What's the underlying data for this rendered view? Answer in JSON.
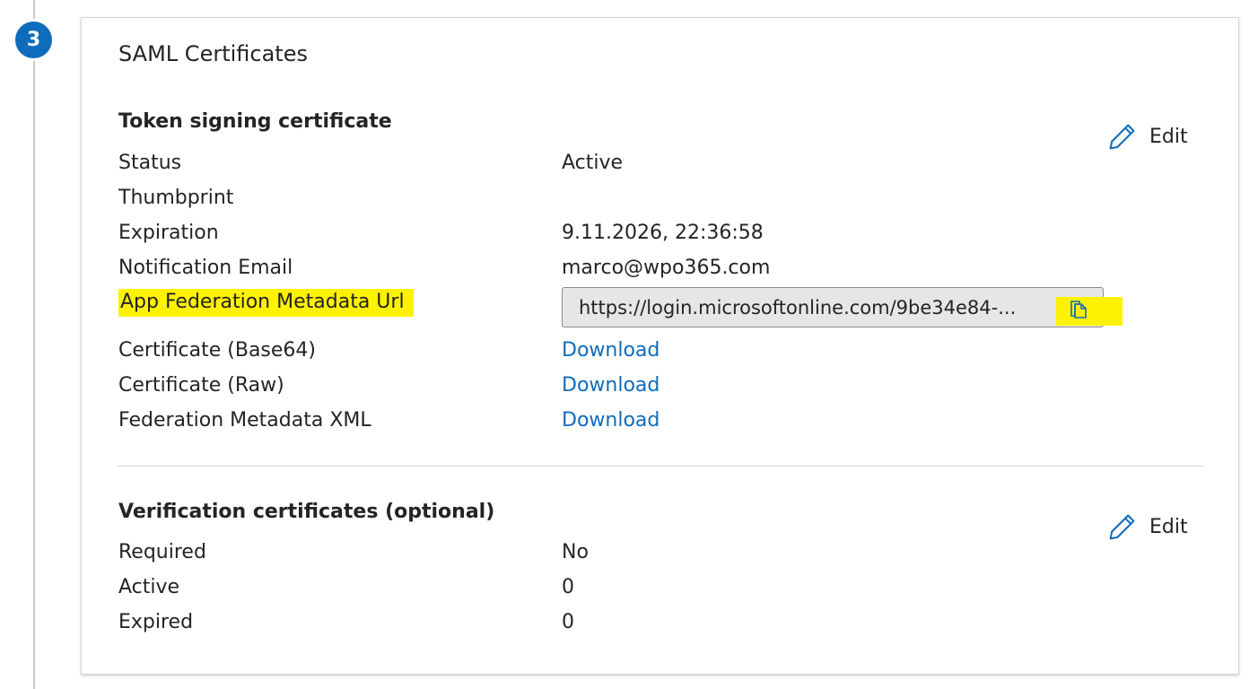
{
  "step": {
    "number": "3"
  },
  "card": {
    "title": "SAML Certificates"
  },
  "token_signing": {
    "title": "Token signing certificate",
    "edit_label": "Edit",
    "rows": {
      "status": {
        "label": "Status",
        "value": "Active"
      },
      "thumbprint": {
        "label": "Thumbprint",
        "value": ""
      },
      "expiration": {
        "label": "Expiration",
        "value": "9.11.2026, 22:36:58"
      },
      "notification_email": {
        "label": "Notification Email",
        "value": "marco@wpo365.com"
      },
      "metadata_url": {
        "label": "App Federation Metadata Url",
        "value": "https://login.microsoftonline.com/9be34e84-..."
      },
      "cert_base64": {
        "label": "Certificate (Base64)",
        "value": "Download"
      },
      "cert_raw": {
        "label": "Certificate (Raw)",
        "value": "Download"
      },
      "federation_xml": {
        "label": "Federation Metadata XML",
        "value": "Download"
      }
    }
  },
  "verification": {
    "title": "Verification certificates (optional)",
    "edit_label": "Edit",
    "rows": {
      "required": {
        "label": "Required",
        "value": "No"
      },
      "active": {
        "label": "Active",
        "value": "0"
      },
      "expired": {
        "label": "Expired",
        "value": "0"
      }
    }
  },
  "colors": {
    "accent": "#0f6cbd",
    "highlight": "#fff200",
    "url_box_bg": "#e6e6e6"
  },
  "icons": {
    "edit": "pencil-icon",
    "copy": "copy-icon"
  }
}
